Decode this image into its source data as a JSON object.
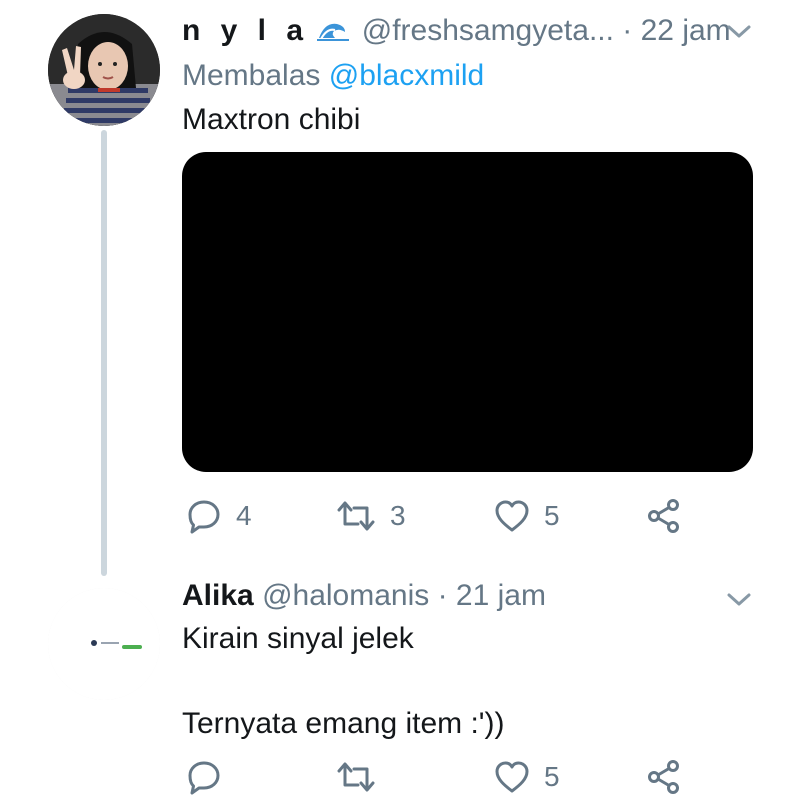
{
  "tweets": [
    {
      "display_name": "n y l a",
      "handle": "@freshsamgyeta...",
      "time": "· 22 jam",
      "reply_prefix": "Membalas",
      "reply_mention": "@blacxmild",
      "text": "Maxtron chibi",
      "icons": [
        "wave-emoji",
        "chevron-down-icon"
      ],
      "actions": {
        "replies": "4",
        "retweets": "3",
        "likes": "5"
      }
    },
    {
      "display_name": "Alika",
      "handle": "@halomanis",
      "time": "· 21 jam",
      "text_line1": "Kirain sinyal jelek",
      "text_line2": "Ternyata emang item :'))",
      "icons": [
        "chevron-down-icon"
      ],
      "actions": {
        "replies": "",
        "retweets": "",
        "likes": "5"
      }
    }
  ],
  "colors": {
    "text_primary": "#14171a",
    "text_secondary": "#657786",
    "link": "#1da1f2",
    "thread_line": "#ccd6dd",
    "media_background": "#000000"
  }
}
